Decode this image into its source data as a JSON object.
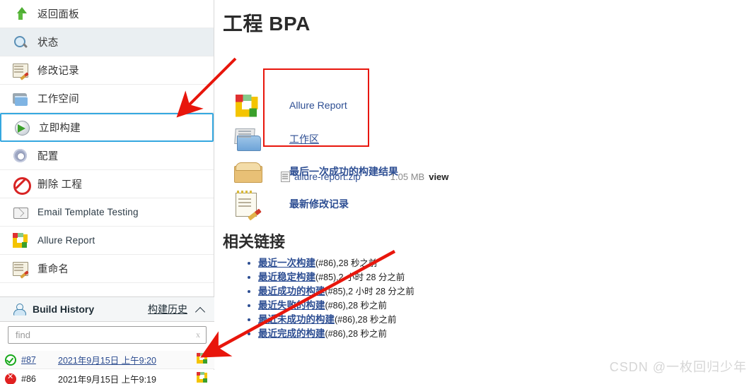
{
  "sidebar": {
    "items": [
      {
        "label": "返回面板",
        "icon": "up-arrow-icon",
        "state": "normal"
      },
      {
        "label": "状态",
        "icon": "search-icon",
        "state": "shaded"
      },
      {
        "label": "修改记录",
        "icon": "notepad-pencil-icon",
        "state": "normal"
      },
      {
        "label": "工作空间",
        "icon": "folder-icon",
        "state": "normal"
      },
      {
        "label": "立即构建",
        "icon": "build-now-icon",
        "state": "selected"
      },
      {
        "label": "配置",
        "icon": "gear-icon",
        "state": "normal"
      },
      {
        "label": "删除 工程",
        "icon": "delete-forbidden-icon",
        "state": "normal"
      },
      {
        "label": "Email Template Testing",
        "icon": "envelope-icon",
        "state": "normal"
      },
      {
        "label": "Allure Report",
        "icon": "allure-logo-icon",
        "state": "normal"
      },
      {
        "label": "重命名",
        "icon": "notepad-pencil-icon",
        "state": "normal"
      }
    ]
  },
  "build_history": {
    "title": "Build History",
    "cn_link": "构建历史",
    "collapse_icon": "chevron-up-icon",
    "find_placeholder": "find",
    "find_value": "",
    "clear_label": "x",
    "rows": [
      {
        "status": "success",
        "number": "#87",
        "date": "2021年9月15日 上午9:20",
        "allure_icon": "allure-logo-icon"
      },
      {
        "status": "failed",
        "number": "#86",
        "date": "2021年9月15日 上午9:19",
        "allure_icon": "allure-logo-icon"
      }
    ]
  },
  "main": {
    "page_title": "工程 BPA",
    "allure_report_link": "Allure Report",
    "workspace_link": "工作区",
    "last_successful_build": "最后一次成功的构建结果",
    "artifact": {
      "name": "allure-report.zip",
      "size": "1.05 MB",
      "view": "view"
    },
    "latest_changes": "最新修改记录",
    "related_heading": "相关链接",
    "related_links": [
      {
        "label": "最近一次构建",
        "meta": "(#86),28 秒之前"
      },
      {
        "label": "最近稳定构建",
        "meta": "(#85),2 小时 28 分之前"
      },
      {
        "label": "最近成功的构建",
        "meta": "(#85),2 小时 28 分之前"
      },
      {
        "label": "最近失败的构建",
        "meta": "(#86),28 秒之前"
      },
      {
        "label": "最近未成功的构建",
        "meta": "(#86),28 秒之前"
      },
      {
        "label": "最近完成的构建",
        "meta": "(#86),28 秒之前"
      }
    ]
  },
  "annotations": {
    "box_color": "#e8160c",
    "arrow_color": "#e8160c",
    "arrow_count": 2
  },
  "watermark": "CSDN @一枚回归少年"
}
